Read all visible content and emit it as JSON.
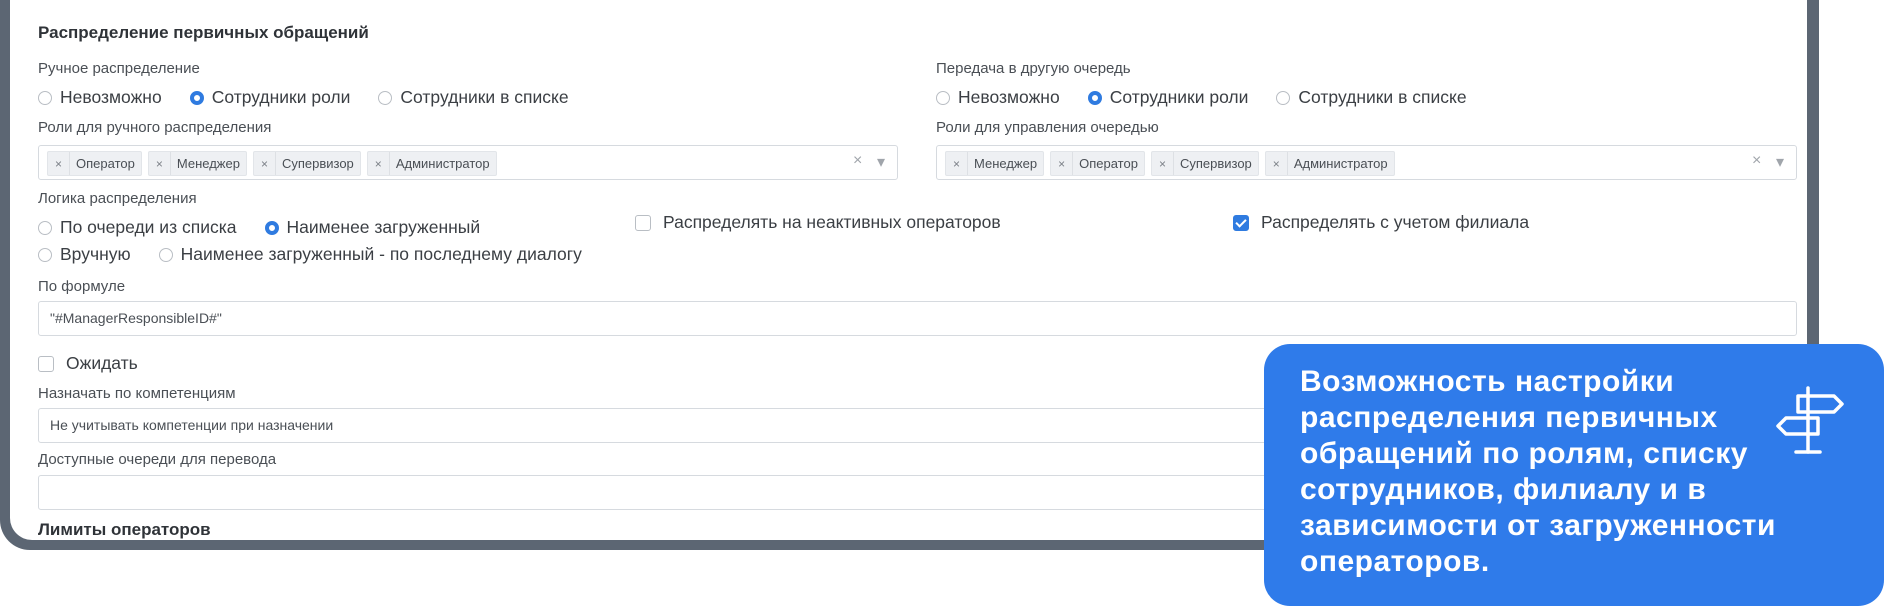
{
  "section": {
    "title": "Распределение первичных обращений"
  },
  "manual": {
    "label": "Ручное распределение",
    "options": [
      "Невозможно",
      "Сотрудники роли",
      "Сотрудники в списке"
    ],
    "selected": 1
  },
  "transfer": {
    "label": "Передача в другую очередь",
    "options": [
      "Невозможно",
      "Сотрудники роли",
      "Сотрудники в списке"
    ],
    "selected": 1
  },
  "roles_manual": {
    "label": "Роли для ручного распределения",
    "tags": [
      "Оператор",
      "Менеджер",
      "Супервизор",
      "Администратор"
    ]
  },
  "roles_queue": {
    "label": "Роли для управления очередью",
    "tags": [
      "Менеджер",
      "Оператор",
      "Супервизор",
      "Администратор"
    ]
  },
  "logic": {
    "label": "Логика распределения",
    "options": [
      "По очереди из списка",
      "Наименее загруженный",
      "Вручную",
      "Наименее загруженный - по последнему диалогу"
    ],
    "selected": 1
  },
  "checkboxes": {
    "inactive": {
      "label": "Распределять на неактивных операторов",
      "checked": false
    },
    "branch": {
      "label": "Распределять с учетом филиала",
      "checked": true
    },
    "wait": {
      "label": "Ожидать",
      "checked": false
    }
  },
  "formula": {
    "label": "По формуле",
    "value": "\"#ManagerResponsibleID#\""
  },
  "competence": {
    "label": "Назначать по компетенциям",
    "value": "Не учитывать компетенции при назначении"
  },
  "queues": {
    "label": "Доступные очереди для перевода",
    "value": ""
  },
  "limits": {
    "title": "Лимиты операторов"
  },
  "icons": {
    "remove": "×",
    "clear": "×",
    "dropdown": "▾"
  },
  "callout": {
    "text": "Возможность настройки распределения первичных обращений по ролям, списку сотрудников, филиалу и в зависимости от загруженности операторов.",
    "icon": "signpost-icon",
    "color": "#2f7bea"
  }
}
